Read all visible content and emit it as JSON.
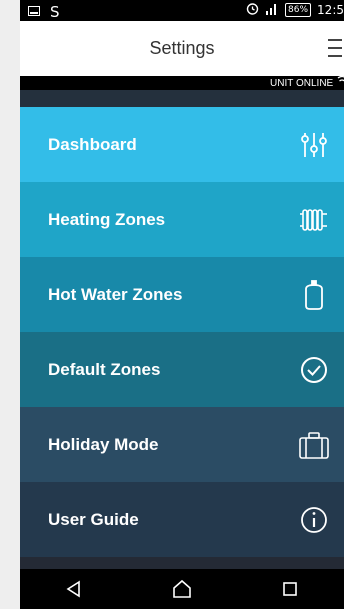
{
  "status_bar": {
    "battery": "86%",
    "time": "12:5"
  },
  "header": {
    "title": "Settings"
  },
  "connection_status": "UNIT ONLINE",
  "menu": {
    "items": [
      {
        "label": "Dashboard",
        "icon": "sliders-icon",
        "color": "#33bde8"
      },
      {
        "label": "Heating Zones",
        "icon": "radiator-icon",
        "color": "#1fa5c8"
      },
      {
        "label": "Hot Water Zones",
        "icon": "water-tank-icon",
        "color": "#1889a9"
      },
      {
        "label": "Default Zones",
        "icon": "check-circle-icon",
        "color": "#1a6f86"
      },
      {
        "label": "Holiday Mode",
        "icon": "suitcase-icon",
        "color": "#2b4c64"
      },
      {
        "label": "User Guide",
        "icon": "info-icon",
        "color": "#24394d"
      }
    ]
  },
  "nav": {
    "buttons": [
      "back-icon",
      "home-icon",
      "recents-icon"
    ]
  }
}
